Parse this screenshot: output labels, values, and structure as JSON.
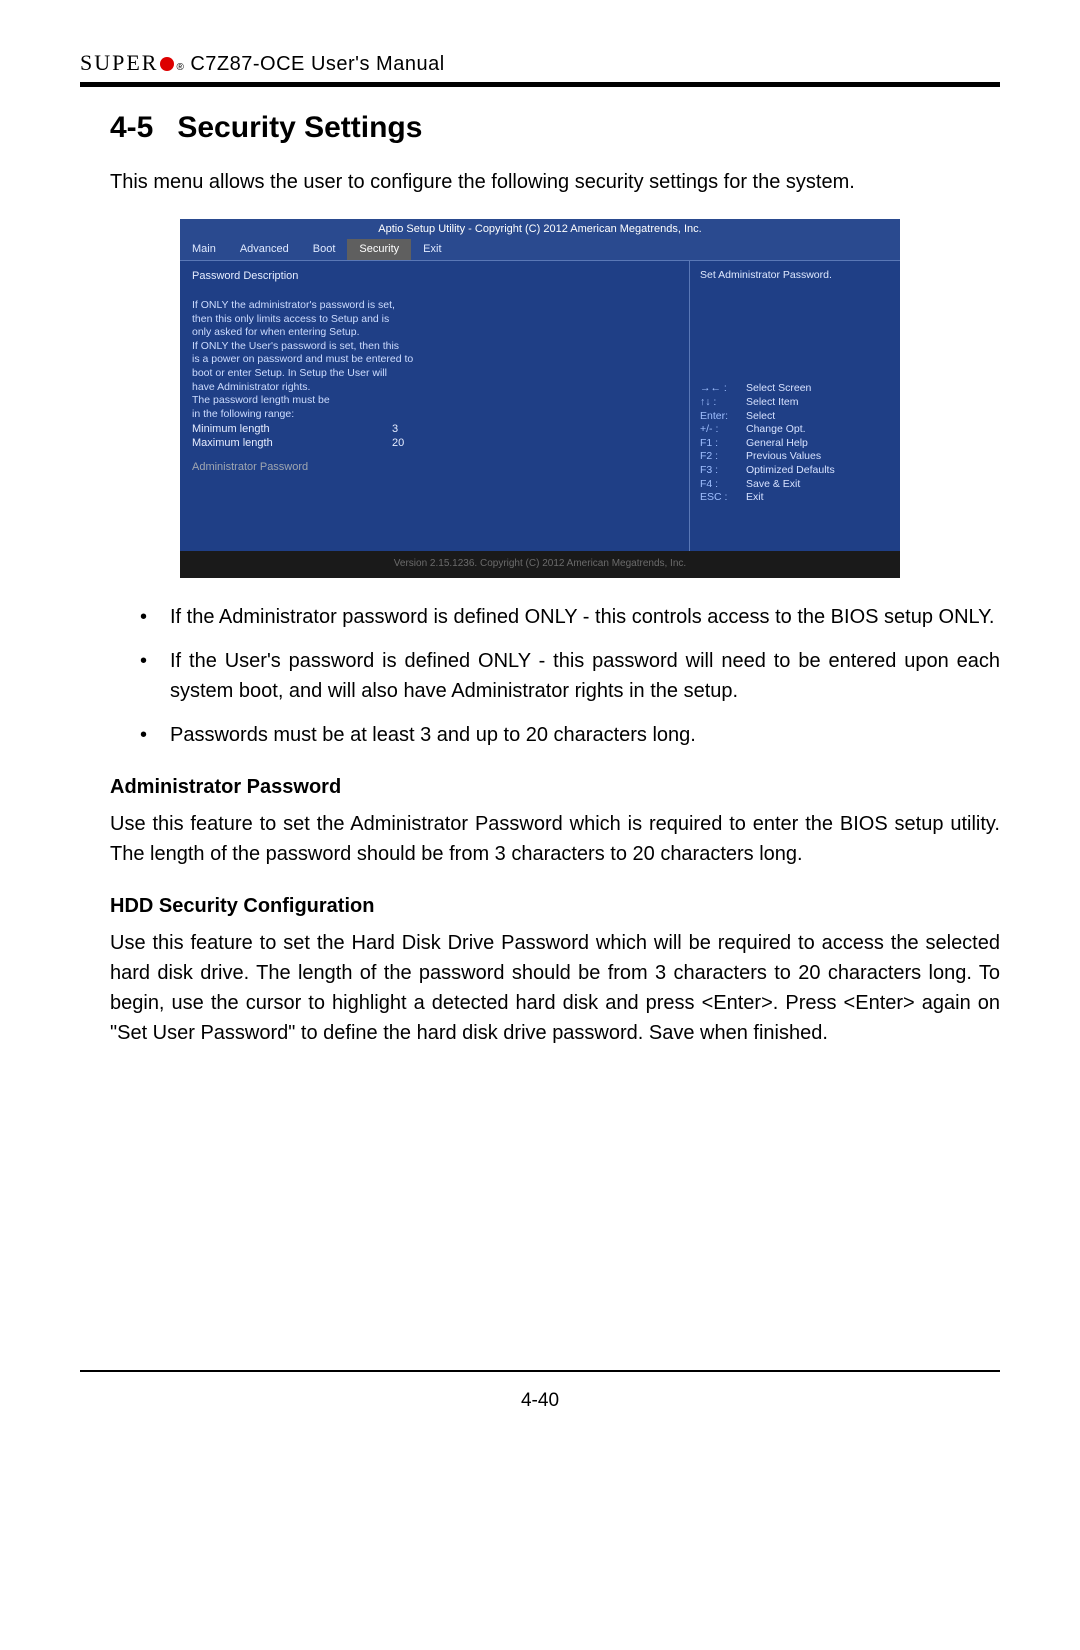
{
  "header": {
    "brand": "SUPER",
    "reg": "®",
    "manual": "C7Z87-OCE User's Manual"
  },
  "section": {
    "number": "4-5",
    "title": "Security Settings",
    "intro": "This menu allows the user to configure the following security settings for the system."
  },
  "bios": {
    "topbar": "Aptio Setup Utility - Copyright (C) 2012 American Megatrends, Inc.",
    "tabs": [
      "Main",
      "Advanced",
      "Boot",
      "Security",
      "Exit"
    ],
    "active_tab_index": 3,
    "left": {
      "desc_title": "Password Description",
      "desc_lines": [
        "If ONLY the administrator's password is set,",
        "then this only limits access to Setup and is",
        "only asked for when entering Setup.",
        "If ONLY the User's password is set, then this",
        "is a power on password and must be entered to",
        "boot or enter Setup.  In Setup the User will",
        "have Administrator rights.",
        "The password length must be",
        "in the following range:"
      ],
      "min_label": "Minimum length",
      "min_value": "3",
      "max_label": "Maximum length",
      "max_value": "20",
      "selected_item": "Administrator Password"
    },
    "right": {
      "help": "Set Administrator Password.",
      "keys": [
        {
          "k": "→← :",
          "d": "Select Screen"
        },
        {
          "k": "↑↓  :",
          "d": "Select Item"
        },
        {
          "k": "Enter:",
          "d": "Select"
        },
        {
          "k": "+/-  :",
          "d": "Change Opt."
        },
        {
          "k": "F1 :",
          "d": "General Help"
        },
        {
          "k": "F2 :",
          "d": "Previous Values"
        },
        {
          "k": "F3 :",
          "d": "Optimized Defaults"
        },
        {
          "k": "F4 :",
          "d": "Save & Exit"
        },
        {
          "k": "ESC :",
          "d": "Exit"
        }
      ]
    },
    "footer": "Version 2.15.1236. Copyright (C) 2012 American Megatrends, Inc."
  },
  "bullets": [
    "If the Administrator password is defined ONLY - this controls access to the BIOS setup ONLY.",
    "If the User's password is defined ONLY - this password will need to be entered upon each system boot, and will also have Administrator rights in the setup.",
    "Passwords must be at least 3 and up to 20 characters long."
  ],
  "sub1": {
    "title": "Administrator Password",
    "body": "Use this feature to set the Administrator Password which is required to enter the BIOS setup utility. The length of the password should be from 3 characters to 20 characters long."
  },
  "sub2": {
    "title": "HDD Security Configuration",
    "body": "Use this feature to set the Hard Disk Drive Password which will be required to access the selected hard disk drive. The length of the password should be from 3 characters to 20 characters long. To begin, use the cursor to highlight a detected hard disk and press <Enter>.  Press <Enter> again on \"Set User Password\" to define the hard disk drive password. Save when finished."
  },
  "page_number": "4-40"
}
